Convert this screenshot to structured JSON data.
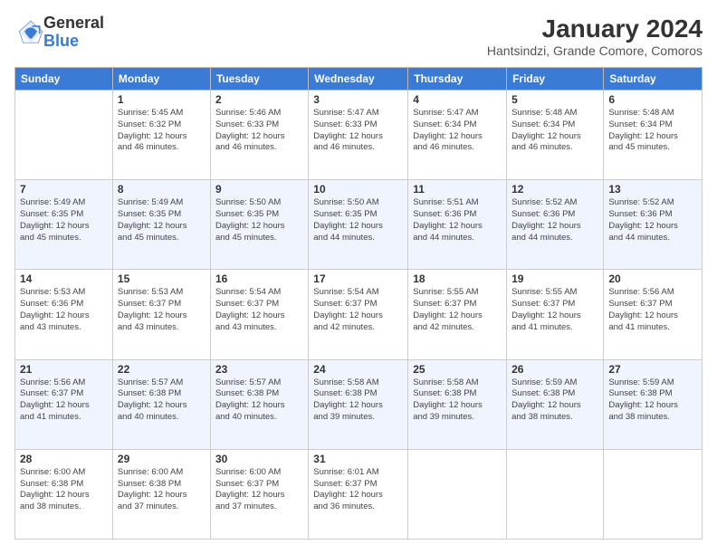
{
  "logo": {
    "general": "General",
    "blue": "Blue"
  },
  "title": "January 2024",
  "location": "Hantsindzi, Grande Comore, Comoros",
  "days_header": [
    "Sunday",
    "Monday",
    "Tuesday",
    "Wednesday",
    "Thursday",
    "Friday",
    "Saturday"
  ],
  "weeks": [
    [
      {
        "day": "",
        "info": ""
      },
      {
        "day": "1",
        "info": "Sunrise: 5:45 AM\nSunset: 6:32 PM\nDaylight: 12 hours\nand 46 minutes."
      },
      {
        "day": "2",
        "info": "Sunrise: 5:46 AM\nSunset: 6:33 PM\nDaylight: 12 hours\nand 46 minutes."
      },
      {
        "day": "3",
        "info": "Sunrise: 5:47 AM\nSunset: 6:33 PM\nDaylight: 12 hours\nand 46 minutes."
      },
      {
        "day": "4",
        "info": "Sunrise: 5:47 AM\nSunset: 6:34 PM\nDaylight: 12 hours\nand 46 minutes."
      },
      {
        "day": "5",
        "info": "Sunrise: 5:48 AM\nSunset: 6:34 PM\nDaylight: 12 hours\nand 46 minutes."
      },
      {
        "day": "6",
        "info": "Sunrise: 5:48 AM\nSunset: 6:34 PM\nDaylight: 12 hours\nand 45 minutes."
      }
    ],
    [
      {
        "day": "7",
        "info": "Sunrise: 5:49 AM\nSunset: 6:35 PM\nDaylight: 12 hours\nand 45 minutes."
      },
      {
        "day": "8",
        "info": "Sunrise: 5:49 AM\nSunset: 6:35 PM\nDaylight: 12 hours\nand 45 minutes."
      },
      {
        "day": "9",
        "info": "Sunrise: 5:50 AM\nSunset: 6:35 PM\nDaylight: 12 hours\nand 45 minutes."
      },
      {
        "day": "10",
        "info": "Sunrise: 5:50 AM\nSunset: 6:35 PM\nDaylight: 12 hours\nand 44 minutes."
      },
      {
        "day": "11",
        "info": "Sunrise: 5:51 AM\nSunset: 6:36 PM\nDaylight: 12 hours\nand 44 minutes."
      },
      {
        "day": "12",
        "info": "Sunrise: 5:52 AM\nSunset: 6:36 PM\nDaylight: 12 hours\nand 44 minutes."
      },
      {
        "day": "13",
        "info": "Sunrise: 5:52 AM\nSunset: 6:36 PM\nDaylight: 12 hours\nand 44 minutes."
      }
    ],
    [
      {
        "day": "14",
        "info": "Sunrise: 5:53 AM\nSunset: 6:36 PM\nDaylight: 12 hours\nand 43 minutes."
      },
      {
        "day": "15",
        "info": "Sunrise: 5:53 AM\nSunset: 6:37 PM\nDaylight: 12 hours\nand 43 minutes."
      },
      {
        "day": "16",
        "info": "Sunrise: 5:54 AM\nSunset: 6:37 PM\nDaylight: 12 hours\nand 43 minutes."
      },
      {
        "day": "17",
        "info": "Sunrise: 5:54 AM\nSunset: 6:37 PM\nDaylight: 12 hours\nand 42 minutes."
      },
      {
        "day": "18",
        "info": "Sunrise: 5:55 AM\nSunset: 6:37 PM\nDaylight: 12 hours\nand 42 minutes."
      },
      {
        "day": "19",
        "info": "Sunrise: 5:55 AM\nSunset: 6:37 PM\nDaylight: 12 hours\nand 41 minutes."
      },
      {
        "day": "20",
        "info": "Sunrise: 5:56 AM\nSunset: 6:37 PM\nDaylight: 12 hours\nand 41 minutes."
      }
    ],
    [
      {
        "day": "21",
        "info": "Sunrise: 5:56 AM\nSunset: 6:37 PM\nDaylight: 12 hours\nand 41 minutes."
      },
      {
        "day": "22",
        "info": "Sunrise: 5:57 AM\nSunset: 6:38 PM\nDaylight: 12 hours\nand 40 minutes."
      },
      {
        "day": "23",
        "info": "Sunrise: 5:57 AM\nSunset: 6:38 PM\nDaylight: 12 hours\nand 40 minutes."
      },
      {
        "day": "24",
        "info": "Sunrise: 5:58 AM\nSunset: 6:38 PM\nDaylight: 12 hours\nand 39 minutes."
      },
      {
        "day": "25",
        "info": "Sunrise: 5:58 AM\nSunset: 6:38 PM\nDaylight: 12 hours\nand 39 minutes."
      },
      {
        "day": "26",
        "info": "Sunrise: 5:59 AM\nSunset: 6:38 PM\nDaylight: 12 hours\nand 38 minutes."
      },
      {
        "day": "27",
        "info": "Sunrise: 5:59 AM\nSunset: 6:38 PM\nDaylight: 12 hours\nand 38 minutes."
      }
    ],
    [
      {
        "day": "28",
        "info": "Sunrise: 6:00 AM\nSunset: 6:38 PM\nDaylight: 12 hours\nand 38 minutes."
      },
      {
        "day": "29",
        "info": "Sunrise: 6:00 AM\nSunset: 6:38 PM\nDaylight: 12 hours\nand 37 minutes."
      },
      {
        "day": "30",
        "info": "Sunrise: 6:00 AM\nSunset: 6:37 PM\nDaylight: 12 hours\nand 37 minutes."
      },
      {
        "day": "31",
        "info": "Sunrise: 6:01 AM\nSunset: 6:37 PM\nDaylight: 12 hours\nand 36 minutes."
      },
      {
        "day": "",
        "info": ""
      },
      {
        "day": "",
        "info": ""
      },
      {
        "day": "",
        "info": ""
      }
    ]
  ]
}
